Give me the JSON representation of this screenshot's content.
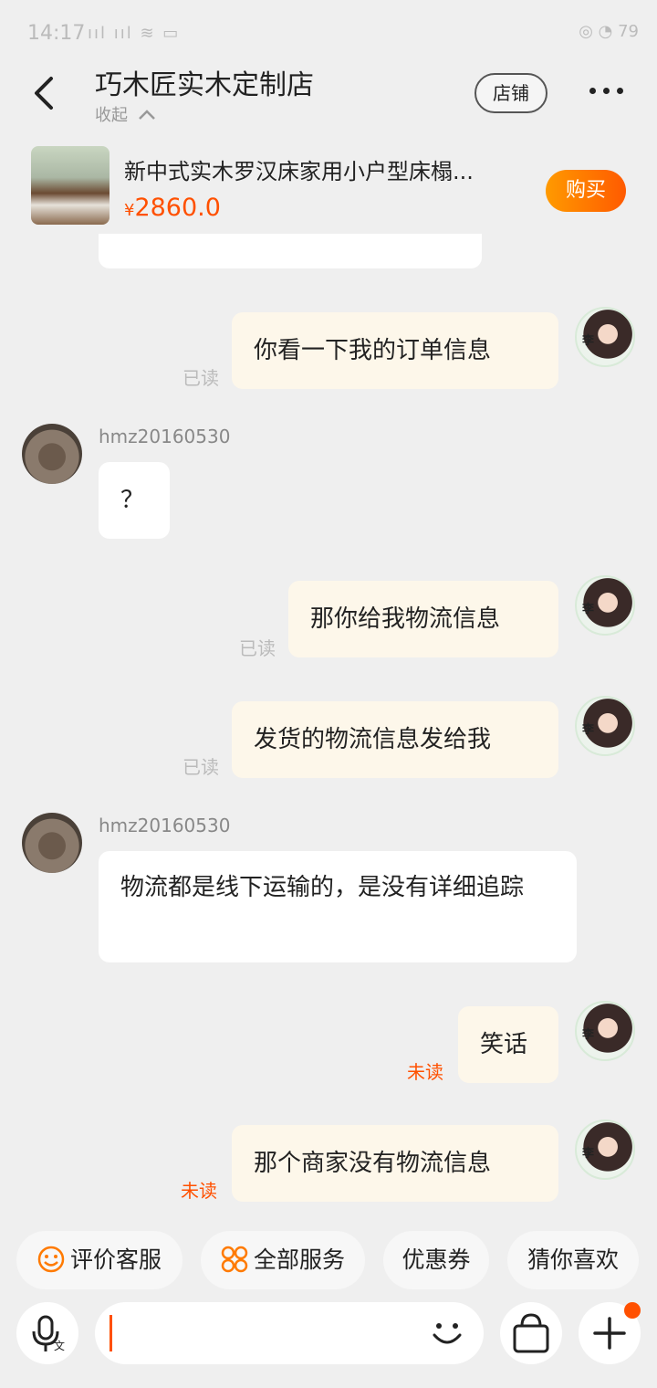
{
  "status_bar": {
    "time": "14:17",
    "signal": "Sıll Sıll",
    "battery": "79"
  },
  "header": {
    "title": "巧木匠实木定制店",
    "collapse_label": "收起",
    "shop_button": "店铺"
  },
  "product": {
    "name": "新中式实木罗汉床家用小户型床榻...",
    "currency": "¥",
    "price": "2860.0",
    "buy_button": "购买"
  },
  "messages": [
    {
      "side": "me",
      "text": "你看一下我的订单信息",
      "status": "已读"
    },
    {
      "side": "them",
      "sender": "hmz20160530",
      "text": "？"
    },
    {
      "side": "me",
      "text": "那你给我物流信息",
      "status": "已读"
    },
    {
      "side": "me",
      "text": "发货的物流信息发给我",
      "status": "已读"
    },
    {
      "side": "them",
      "sender": "hmz20160530",
      "text": "物流都是线下运输的，是没有详细追踪"
    },
    {
      "side": "me",
      "text": "笑话",
      "status": "未读"
    },
    {
      "side": "me",
      "text": "那个商家没有物流信息",
      "status": "未读"
    }
  ],
  "avatar_me_label": "李",
  "quick_actions": [
    {
      "label": "评价客服",
      "icon": "smile-icon"
    },
    {
      "label": "全部服务",
      "icon": "grid-icon"
    },
    {
      "label": "优惠券"
    },
    {
      "label": "猜你喜欢"
    }
  ],
  "input": {
    "placeholder": ""
  },
  "colors": {
    "accent": "#ff5000",
    "my_bubble": "#fdf7ea",
    "their_bubble": "#ffffff",
    "background": "#efefef"
  }
}
